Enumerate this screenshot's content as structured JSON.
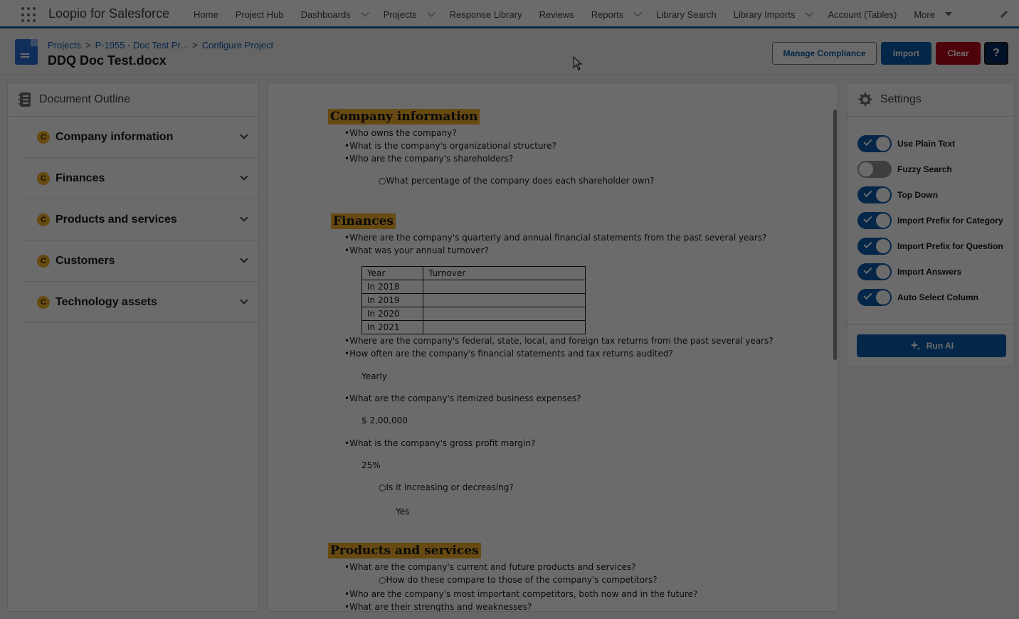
{
  "app": {
    "name": "Loopio for Salesforce",
    "nav": [
      {
        "label": "Home",
        "chevron": false
      },
      {
        "label": "Project Hub",
        "chevron": false
      },
      {
        "label": "Dashboards",
        "chevron": true
      },
      {
        "label": "Projects",
        "chevron": true
      },
      {
        "label": "Response Library",
        "chevron": false
      },
      {
        "label": "Reviews",
        "chevron": false
      },
      {
        "label": "Reports",
        "chevron": true
      },
      {
        "label": "Library Search",
        "chevron": false
      },
      {
        "label": "Library Imports",
        "chevron": true
      },
      {
        "label": "Account (Tables)",
        "chevron": false
      }
    ],
    "more_label": "More"
  },
  "header": {
    "breadcrumb": [
      "Projects",
      "P-1955 - Doc Test Pr...",
      "Configure Project"
    ],
    "separator": ">",
    "title": "DDQ Doc Test.docx",
    "buttons": {
      "manage_compliance": "Manage Compliance",
      "import": "Import",
      "clear": "Clear",
      "help": "?"
    }
  },
  "outline": {
    "title": "Document Outline",
    "badge": "C",
    "items": [
      "Company information",
      "Finances",
      "Products and services",
      "Customers",
      "Technology assets"
    ]
  },
  "document": {
    "headings": [
      "Company information",
      "Finances",
      "Products and services"
    ],
    "lines": [
      "•Who owns the company?",
      "•What is the company's organizational structure?",
      "•Who are the company's shareholders?",
      "○What percentage of the company does each shareholder own?",
      "•Where are the company's quarterly and annual financial statements from the past several years?",
      "•What was your annual turnover?",
      "•Where are the company's federal, state, local, and foreign tax returns from the past several years?",
      "•How often are the company's financial statements and tax returns audited?",
      "Yearly",
      "•What are the company's itemized business expenses?",
      "$ 2,00,000",
      "•What is the company's gross profit margin?",
      "25%",
      "○Is it increasing or decreasing?",
      "Yes",
      "•What are the company's current and future products and services?",
      "○How do these compare to those of the company's competitors?",
      "•Who are the company's most important competitors, both now and in the future?",
      "•What are their strengths and weaknesses?"
    ],
    "table": {
      "header": [
        "Year",
        "Turnover"
      ],
      "rows": [
        [
          "In 2018",
          ""
        ],
        [
          "In 2019",
          ""
        ],
        [
          "In 2020",
          ""
        ],
        [
          "In 2021",
          ""
        ]
      ]
    }
  },
  "settings": {
    "title": "Settings",
    "toggles": [
      {
        "label": "Use Plain Text",
        "on": true
      },
      {
        "label": "Fuzzy Search",
        "on": false
      },
      {
        "label": "Top Down",
        "on": true
      },
      {
        "label": "Import Prefix for Category",
        "on": true
      },
      {
        "label": "Import Prefix for Question",
        "on": true
      },
      {
        "label": "Import Answers",
        "on": true
      },
      {
        "label": "Auto Select Column",
        "on": true
      }
    ],
    "run_ai": "Run AI"
  }
}
